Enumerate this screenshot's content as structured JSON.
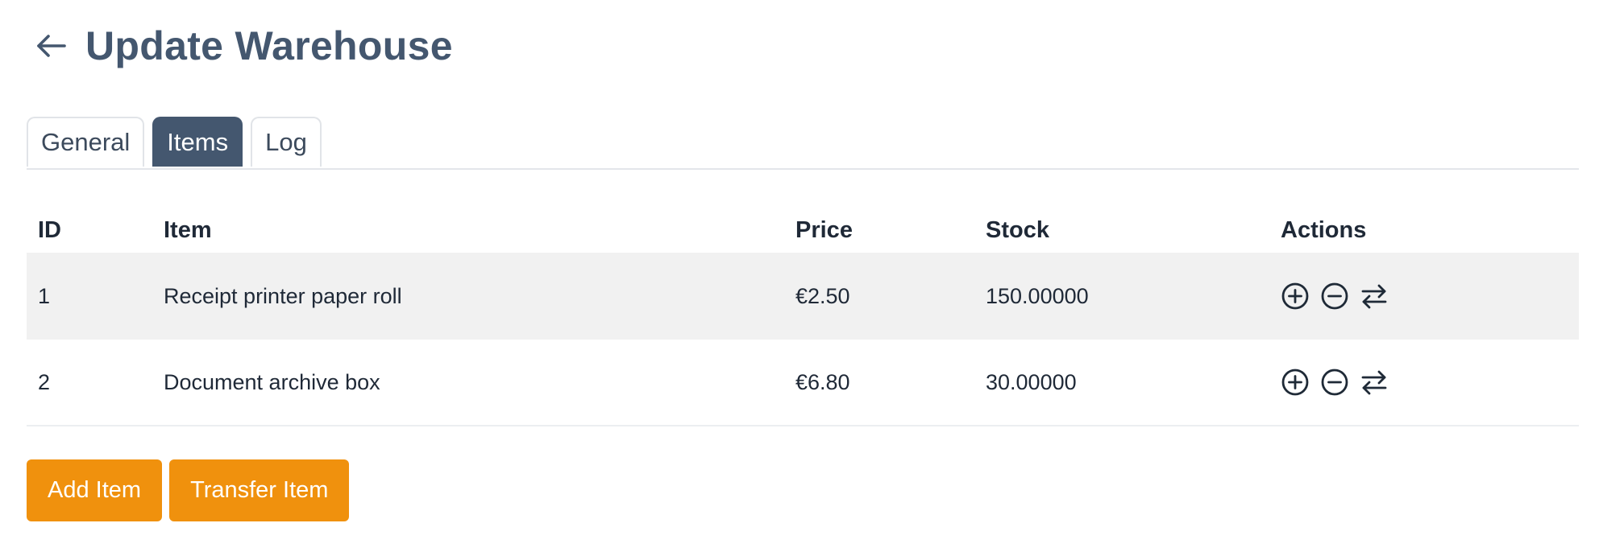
{
  "page": {
    "title": "Update Warehouse",
    "back_icon": "arrow-left-icon",
    "accent": "#44576f"
  },
  "tabs": [
    {
      "label": "General",
      "active": false
    },
    {
      "label": "Items",
      "active": true
    },
    {
      "label": "Log",
      "active": false
    }
  ],
  "table": {
    "headers": {
      "id": "ID",
      "item": "Item",
      "price": "Price",
      "stock": "Stock",
      "actions": "Actions"
    },
    "rows": [
      {
        "id": "1",
        "item": "Receipt printer paper roll",
        "price": "€2.50",
        "stock": "150.00000"
      },
      {
        "id": "2",
        "item": "Document archive box",
        "price": "€6.80",
        "stock": "30.00000"
      }
    ],
    "action_icons": [
      "plus-circle-icon",
      "minus-circle-icon",
      "transfer-arrows-icon"
    ]
  },
  "buttons": {
    "add_item": "Add Item",
    "transfer_item": "Transfer Item",
    "color": "#f0910d"
  }
}
